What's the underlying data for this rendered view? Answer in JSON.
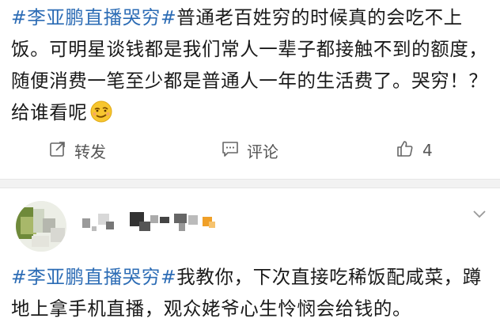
{
  "post": {
    "topic": "#李亚鹏直播哭穷#",
    "text": "普通老百姓穷的时候真的会吃不上饭。可明星谈钱都是我们常人一辈子都接触不到的额度，随便消费一笔至少都是普通人一年的生活费了。哭穷！？给谁看呢",
    "emoji": "smirk-emoji-icon"
  },
  "actions": {
    "repost_label": "转发",
    "comment_label": "评论",
    "like_count": "4"
  },
  "comment": {
    "topic": "#李亚鹏直播哭穷#",
    "text": "我教你，下次直接吃稀饭配咸菜，蹲地上拿手机直播，观众姥爷心生怜悯会给钱的。"
  },
  "colors": {
    "topic": "#2c6cb5",
    "action_gray": "#555555",
    "separator": "#f2f2f2"
  }
}
